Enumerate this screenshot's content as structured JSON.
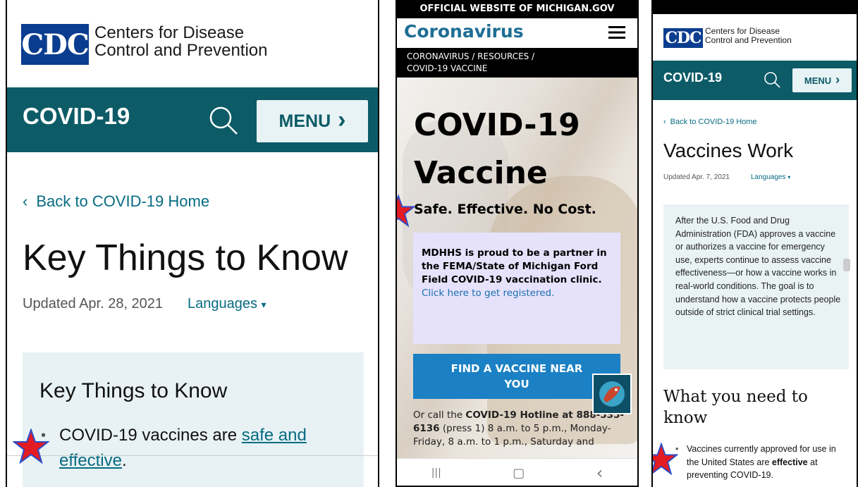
{
  "colors": {
    "cdc_teal": "#0c5b67",
    "cdc_blue": "#0a3d8f",
    "link": "#076b82",
    "michigan_blue": "#1b80c4",
    "notice_bg": "#e6e2fb",
    "star_red": "#e31b23",
    "star_blue": "#2b4cc8"
  },
  "panel1": {
    "logo": "CDC",
    "org_line1": "Centers for Disease",
    "org_line2": "Control and Prevention",
    "section_title": "COVID-19",
    "search_icon": "search-icon",
    "menu_label": "MENU",
    "menu_chevron": "›",
    "back_chevron": "‹",
    "back_link": "Back to COVID-19 Home",
    "title": "Key Things to Know",
    "updated": "Updated Apr. 28, 2021",
    "languages": "Languages",
    "caret": "▾",
    "callout_heading": "Key Things to Know",
    "bullet_text_pre": "COVID-19 vaccines are ",
    "bullet_link_1": "safe and",
    "bullet_link_2": "effective",
    "bullet_text_post": "."
  },
  "panel2": {
    "official_banner": "OFFICIAL WEBSITE OF MICHIGAN.GOV",
    "site_title": "Coronavirus",
    "hamburger_icon": "hamburger-icon",
    "breadcrumb_line1": "CORONAVIRUS /  RESOURCES /",
    "breadcrumb_line2": "COVID-19 VACCINE",
    "hero_title_1": "COVID-19",
    "hero_title_2": "Vaccine",
    "tagline": "Safe. Effective. No Cost.",
    "notice_text": "MDHHS is proud to be a partner in the FEMA/State of Michigan Ford Field COVID-19 vaccination clinic.",
    "notice_link": "Click here to get registered.",
    "find_button_1": "FIND A VACCINE NEAR",
    "find_button_2": "YOU",
    "call_pre": "Or call the ",
    "call_bold": "COVID-19 Hotline at 888-535-6136",
    "call_post": " (press 1) 8 a.m. to 5 p.m., Monday-Friday, 8 a.m. to 1 p.m., Saturday and",
    "nav_recent": "|||",
    "nav_home": "▢",
    "nav_back": "‹"
  },
  "panel3": {
    "logo": "CDC",
    "org_line1": "Centers for Disease",
    "org_line2": "Control and Prevention",
    "section_title": "COVID-19",
    "menu_label": "MENU",
    "menu_chevron": "›",
    "back_chevron": "‹",
    "back_link": "Back to COVID-19 Home",
    "title": "Vaccines Work",
    "updated": "Updated Apr. 7, 2021",
    "languages": "Languages",
    "caret": "▾",
    "callout_text": "After the U.S. Food and Drug Administration (FDA) approves a vaccine or authorizes a vaccine for emergency use, experts continue to assess vaccine effectiveness—or how a vaccine works in real-world conditions.  The goal is to understand how a vaccine protects people outside of strict clinical trial settings.",
    "h2_line1": "What you need to",
    "h2_line2": "know",
    "bullet_pre": "Vaccines currently approved for use in the United States are ",
    "bullet_bold": "effective",
    "bullet_post": " at preventing COVID-19."
  }
}
